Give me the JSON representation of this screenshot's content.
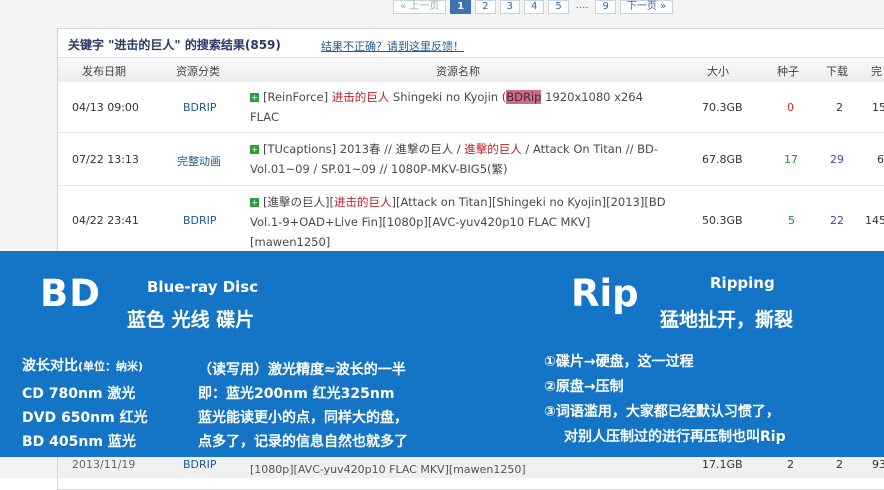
{
  "pager": {
    "prev": "« 上一页",
    "pages": [
      "1",
      "2",
      "3",
      "4",
      "5"
    ],
    "ellipsis": "....",
    "last": "9",
    "next": "下一页 »"
  },
  "results": {
    "title": "关键字 \"进击的巨人\" 的搜索结果(859)",
    "feedback": "结果不正确？请到这里反馈！"
  },
  "columns": [
    "发布日期",
    "资源分类",
    "资源名称",
    "大小",
    "种子",
    "下载",
    "完"
  ],
  "rows": [
    {
      "date": "04/13 09:00",
      "category": "BDRIP",
      "name_pre": "[ReinForce] ",
      "name_red": "进击的巨人",
      "name_mid": " Shingeki no Kyojin (",
      "name_hl": "BDRip",
      "name_post": " 1920x1080 x264 FLAC",
      "size": "70.3GB",
      "seeds": "0",
      "downloads": "2",
      "complete": "15"
    },
    {
      "date": "07/22 13:13",
      "category": "完整动画",
      "name_pre": "[TUcaptions] 2013春 // 進撃の巨人 / ",
      "name_red": "進擊的巨人",
      "name_post": " / Attack On Titan // BD-Vol.01~09 / SP.01~09 // 1080P-MKV-BIG5(繁)",
      "size": "67.8GB",
      "seeds": "17",
      "downloads": "29",
      "complete": "6"
    },
    {
      "date": "04/22 23:41",
      "category": "BDRIP",
      "name_pre": "[進擊の巨人][",
      "name_red": "进击的巨人",
      "name_post": "][Attack on Titan][Shingeki no Kyojin][2013][BD Vol.1-9+OAD+Live Fin][1080p][AVC-yuv420p10 FLAC MKV][mawen1250]",
      "size": "50.3GB",
      "seeds": "5",
      "downloads": "22",
      "complete": "145"
    }
  ],
  "hidden_row": {
    "date": "2013/11/19",
    "category": "BDRIP",
    "name": "[1080p][AVC-yuv420p10 FLAC MKV][mawen1250]",
    "size": "17.1GB",
    "seeds": "2",
    "downloads": "2",
    "complete": "93"
  },
  "overlay": {
    "bd": "BD",
    "bluray": "Blue-ray Disc",
    "bd_cn": "蓝色  光线  碟片",
    "rip": "Rip",
    "ripping": "Ripping",
    "rip_cn": "猛地扯开，撕裂",
    "wave_title": "波长对比",
    "wave_unit": "(单位：纳米)",
    "cd": "CD    780nm 激光",
    "dvd": "DVD 650nm 红光",
    "bdline": "BD    405nm 蓝光",
    "explain1": "（读写用）激光精度≈波长的一半",
    "explain2": "即：蓝光200nm 红光325nm",
    "explain3": "蓝光能读更小的点，同样大的盘，",
    "explain4": "点多了，记录的信息自然也就多了",
    "point1": "①碟片→硬盘，这一过程",
    "point2": "②原盘→压制",
    "point3": "③词语滥用，大家都已经默认习惯了，",
    "point4": "对别人压制过的进行再压制也叫Rip"
  },
  "colors": {
    "overlay_bg": "#1475c7",
    "pager_active": "#3f72b0",
    "highlight": "#d26a87",
    "title_red": "#c0202a",
    "seed_green": "#2a8a2a",
    "seed_red": "#d9261c"
  }
}
